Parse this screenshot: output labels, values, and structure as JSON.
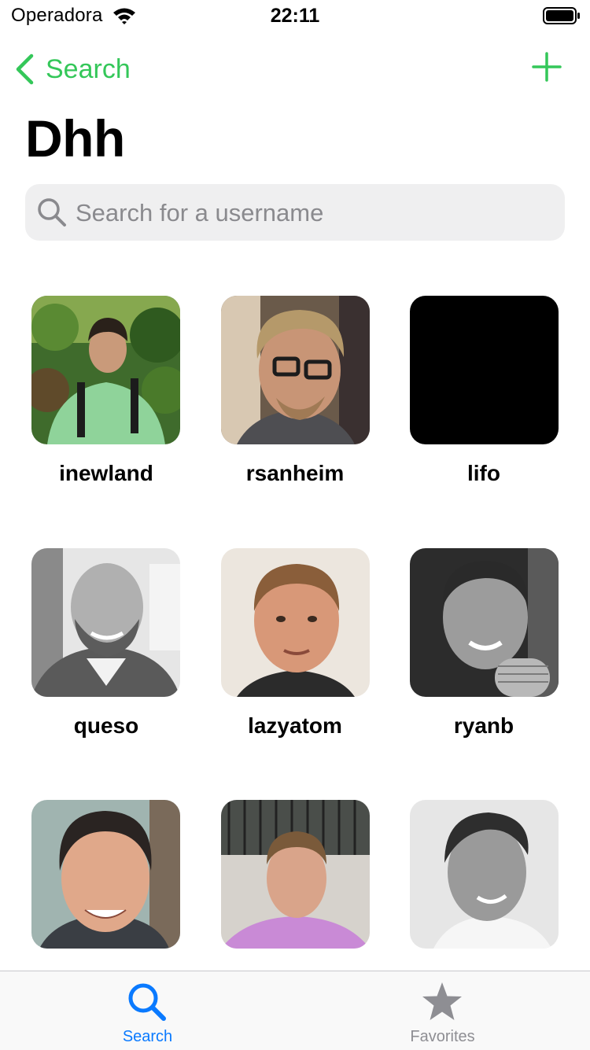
{
  "status_bar": {
    "carrier": "Operadora",
    "time": "22:11"
  },
  "nav": {
    "back_label": "Search"
  },
  "page": {
    "title": "Dhh"
  },
  "search": {
    "placeholder": "Search for a username",
    "value": ""
  },
  "colors": {
    "accent_green": "#34c759",
    "tab_active_blue": "#0a7aff",
    "tab_inactive_gray": "#8e8e93",
    "search_bg": "#efeff0"
  },
  "users": [
    {
      "username": "inewland"
    },
    {
      "username": "rsanheim"
    },
    {
      "username": "lifo"
    },
    {
      "username": "queso"
    },
    {
      "username": "lazyatom"
    },
    {
      "username": "ryanb"
    },
    {
      "username": ""
    },
    {
      "username": ""
    },
    {
      "username": ""
    }
  ],
  "tab_bar": {
    "tabs": [
      {
        "label": "Search",
        "icon": "search-icon",
        "active": true
      },
      {
        "label": "Favorites",
        "icon": "star-icon",
        "active": false
      }
    ]
  }
}
